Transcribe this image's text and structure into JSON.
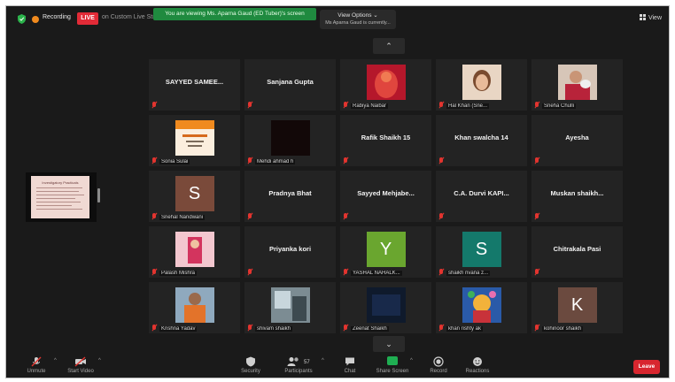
{
  "topbar": {
    "recording_label": "Recording",
    "live_badge": "LIVE",
    "live_url": "on Custom Live Streaming Service",
    "viewing_banner": "You are viewing Ms. Aparna Gaud (ED Tuber)'s screen",
    "view_options_label": "View Options ⌄",
    "view_options_sub": "Ms Aparna Gaud is currently...",
    "view_button": "View",
    "colors": {
      "live": "#e22b37",
      "banner": "#1f8a3f",
      "recording": "#f08a1e"
    }
  },
  "shared_screen": {
    "doc_title": "Investigatory Practicals"
  },
  "pagination": {
    "up_icon": "chevron-up-icon",
    "down_icon": "chevron-down-icon"
  },
  "tiles": [
    {
      "name": "SAYYED SAMEE...",
      "label": "",
      "muted": true
    },
    {
      "name": "Sanjana Gupta",
      "label": "",
      "muted": true
    },
    {
      "name": "",
      "label": "Rabiya Naibar",
      "muted": true,
      "image": "ganesh-idol"
    },
    {
      "name": "",
      "label": "Hal Khan (Sne...",
      "muted": true,
      "image": "girl-selfie"
    },
    {
      "name": "",
      "label": "Sneha Chulli",
      "muted": true,
      "image": "girl-with-pet"
    },
    {
      "name": "",
      "label": "Sonia Sulai",
      "muted": true,
      "image": "orange-poster"
    },
    {
      "name": "",
      "label": "Mehdi ahmad h",
      "muted": true,
      "image": "dark-video"
    },
    {
      "name": "Rafik Shaikh 15",
      "label": "",
      "muted": true
    },
    {
      "name": "Khan swalcha 14",
      "label": "",
      "muted": true
    },
    {
      "name": "Ayesha",
      "label": "",
      "muted": true
    },
    {
      "name": "",
      "label": "Snehal Nandwani",
      "muted": true,
      "avatar": "S",
      "avatar_color": "#7a4a3a"
    },
    {
      "name": "Pradnya Bhat",
      "label": "",
      "muted": true
    },
    {
      "name": "Sayyed Mehjabe...",
      "label": "",
      "muted": true
    },
    {
      "name": "C.A. Durvi KAPI...",
      "label": "",
      "muted": true
    },
    {
      "name": "Muskan shaikh...",
      "label": "",
      "muted": true
    },
    {
      "name": "",
      "label": "Palash Mishra",
      "muted": true,
      "image": "pink-poster"
    },
    {
      "name": "Priyanka kori",
      "label": "",
      "muted": true
    },
    {
      "name": "",
      "label": "YASHAL NAHALK...",
      "muted": true,
      "avatar": "Y",
      "avatar_color": "#6aa62f"
    },
    {
      "name": "",
      "label": "shaikh rivana z...",
      "muted": true,
      "avatar": "S",
      "avatar_color": "#14796b"
    },
    {
      "name": "Chitrakala Pasi",
      "label": "",
      "muted": true
    },
    {
      "name": "",
      "label": "Krishna Yadav",
      "muted": true,
      "image": "orange-shirt"
    },
    {
      "name": "",
      "label": "shivam shaikh",
      "muted": true,
      "image": "window-photo"
    },
    {
      "name": "",
      "label": "Zeenat Shaikh",
      "muted": true,
      "image": "dark-blue"
    },
    {
      "name": "",
      "label": "khan rishty ak",
      "muted": true,
      "image": "colorful-deity"
    },
    {
      "name": "",
      "label": "kohinoor shaikh",
      "muted": true,
      "avatar": "K",
      "avatar_color": "#6b4a3f"
    }
  ],
  "toolbar": {
    "unmute": "Unmute",
    "start_video": "Start Video",
    "security": "Security",
    "participants": "Participants",
    "participants_count": "57",
    "chat": "Chat",
    "share_screen": "Share Screen",
    "record": "Record",
    "reactions": "Reactions",
    "leave": "Leave",
    "colors": {
      "share": "#1fae52",
      "leave": "#d8262f",
      "muted": "#e3342f"
    }
  }
}
